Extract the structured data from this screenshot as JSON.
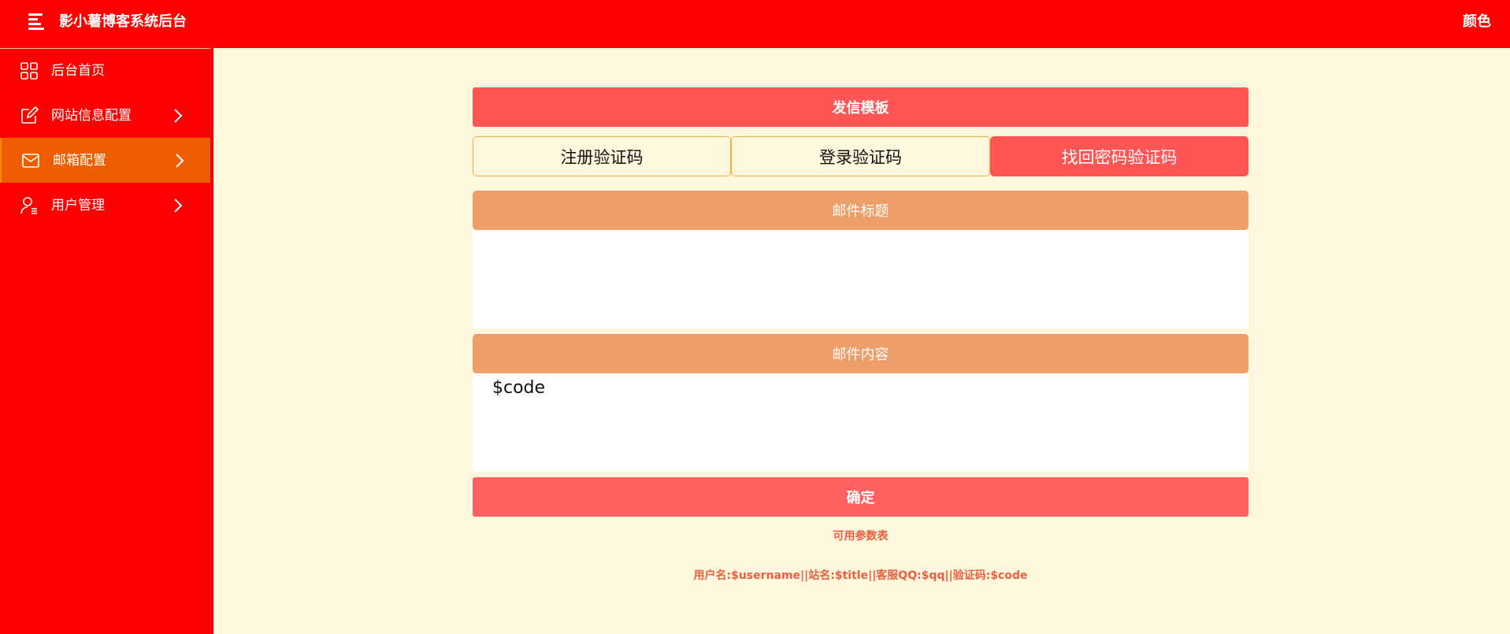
{
  "header": {
    "title": "影小薯博客系统后台",
    "color_label": "颜色"
  },
  "sidebar": {
    "items": [
      {
        "label": "后台首页",
        "icon": "grid-icon",
        "has_arrow": false,
        "active": false
      },
      {
        "label": "网站信息配置",
        "icon": "edit-icon",
        "has_arrow": true,
        "active": false
      },
      {
        "label": "邮箱配置",
        "icon": "mail-icon",
        "has_arrow": true,
        "active": true
      },
      {
        "label": "用户管理",
        "icon": "user-icon",
        "has_arrow": true,
        "active": false
      }
    ]
  },
  "main": {
    "panel_title": "发信模板",
    "tabs": [
      {
        "label": "注册验证码",
        "selected": false
      },
      {
        "label": "登录验证码",
        "selected": false
      },
      {
        "label": "找回密码验证码",
        "selected": true
      }
    ],
    "subject": {
      "label": "邮件标题",
      "value": ""
    },
    "content": {
      "label": "邮件内容",
      "value": "$code"
    },
    "confirm_label": "确定",
    "params_title": "可用参数表",
    "params_text": "用户名:$username||站名:$title||客服QQ:$qq||验证码:$code"
  },
  "colors": {
    "topbar": "#ff0000",
    "sidebar": "#ff0000",
    "active_item": "#ee5e00",
    "background": "#fff7dd",
    "accent": "#ff5555",
    "section_header": "#ee9e68",
    "param_text": "#ee5e40"
  }
}
